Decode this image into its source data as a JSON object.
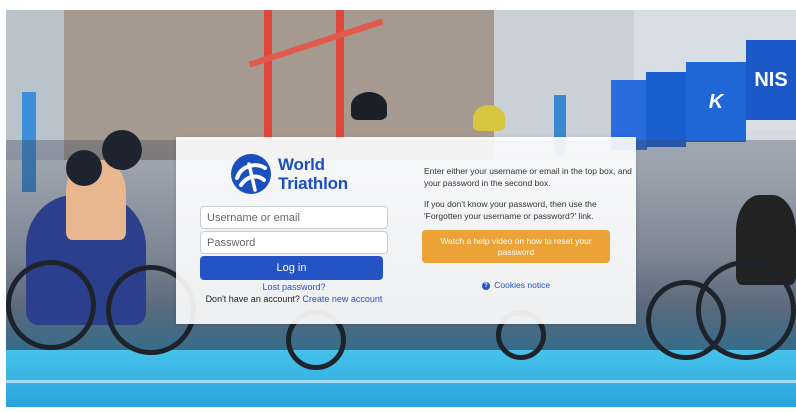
{
  "brand": {
    "name_line1": "World",
    "name_line2": "Triathlon",
    "color": "#1b4fbe"
  },
  "background_banners": {
    "banner_text": "NIS",
    "banner_script": "K"
  },
  "login": {
    "username_placeholder": "Username or email",
    "password_placeholder": "Password",
    "login_button": "Log in",
    "lost_password": "Lost password?",
    "no_account_text": "Don't have an account?",
    "create_account": "Create new account",
    "primary_color": "#2453c6"
  },
  "help": {
    "instructions_1": "Enter either your username or email in the top box, and your password in the second box.",
    "instructions_2": "If you don't know your password, then use the 'Forgotten your username or password?' link.",
    "video_button": "Watch a help video on how to reset your password",
    "video_button_color": "#eba237",
    "cookies_notice": "Cookies notice",
    "cookies_icon": "question-circle-icon"
  }
}
